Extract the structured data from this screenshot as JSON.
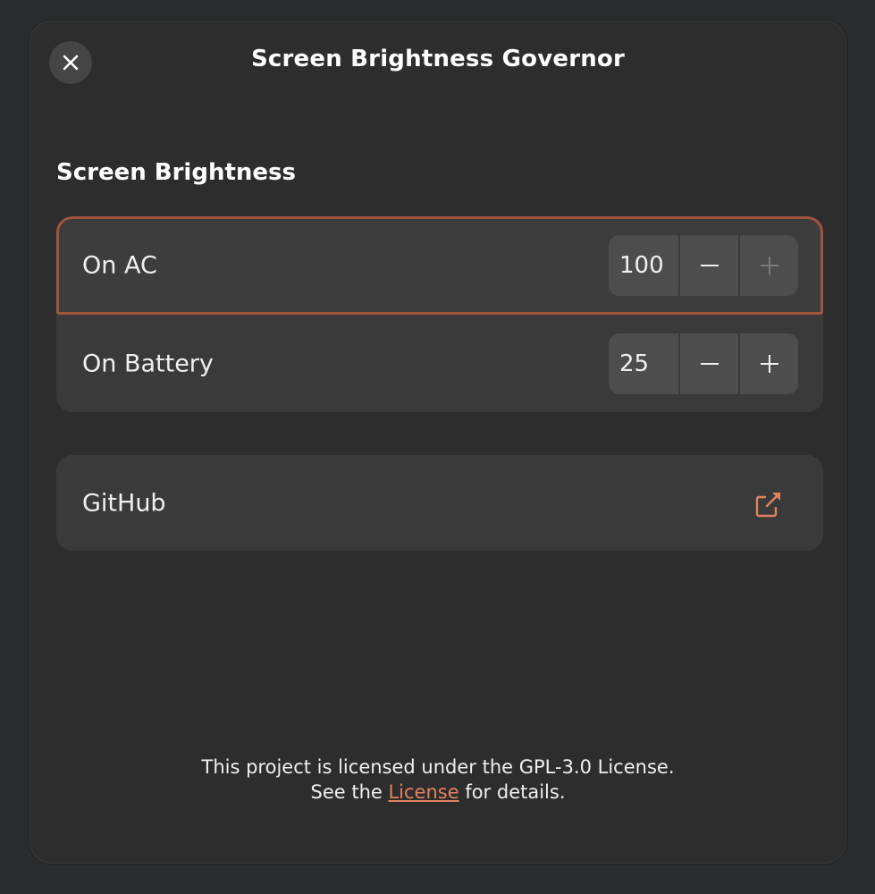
{
  "window": {
    "title": "Screen Brightness Governor"
  },
  "section": {
    "title": "Screen Brightness"
  },
  "rows": [
    {
      "label": "On AC",
      "value": "100",
      "minus_enabled": true,
      "plus_enabled": false
    },
    {
      "label": "On Battery",
      "value": "25",
      "minus_enabled": true,
      "plus_enabled": true
    }
  ],
  "link": {
    "label": "GitHub",
    "icon": "external-link-icon"
  },
  "footer": {
    "line1": "This project is licensed under the GPL-3.0 License.",
    "line2_prefix": "See the ",
    "link_text": "License",
    "line2_suffix": " for details."
  },
  "colors": {
    "accent": "#e0835f",
    "focus_border": "#a0543e",
    "window_bg": "#2d2d2d",
    "card_bg": "#3a3a3a"
  }
}
